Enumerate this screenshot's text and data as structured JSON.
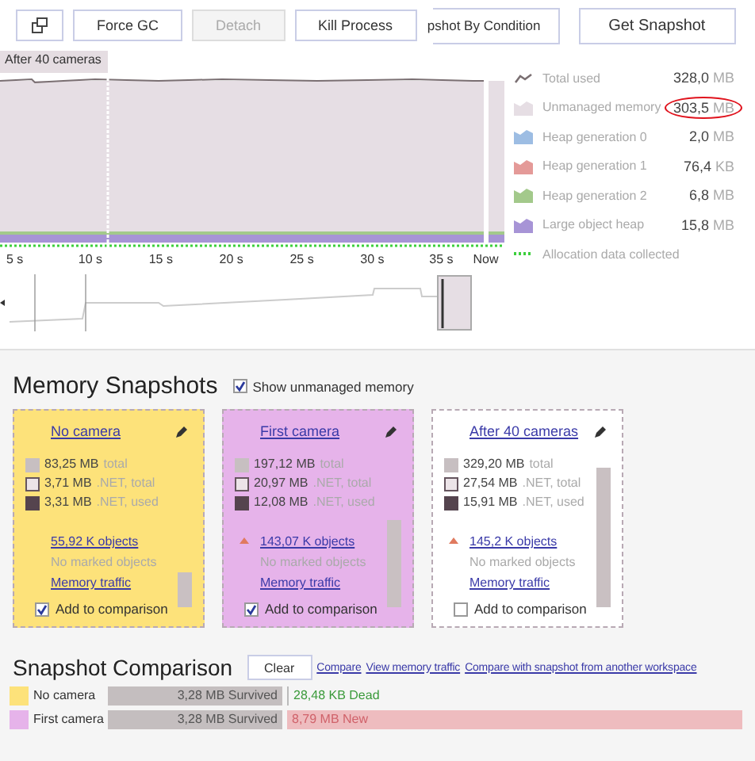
{
  "toolbar": {
    "buttons": [
      {
        "kind": "icon",
        "disabled": false
      },
      {
        "kind": "text",
        "label": "Force GC",
        "disabled": false
      },
      {
        "kind": "text",
        "label": "Detach",
        "disabled": true
      },
      {
        "kind": "text",
        "label": "Kill Process",
        "disabled": false
      },
      {
        "kind": "cut",
        "label": "pshot By Condition",
        "disabled": false
      },
      {
        "kind": "wide",
        "label": "Get Snapshot",
        "disabled": false
      }
    ]
  },
  "timeline": {
    "marker_label": "After 40 cameras",
    "time_axis": [
      "5 s",
      "10 s",
      "15 s",
      "20 s",
      "25 s",
      "30 s",
      "35 s",
      "Now"
    ]
  },
  "legend": [
    {
      "kind": "line",
      "color": "#7a6f72",
      "label": "Total used",
      "value": "328,0",
      "unit": "MB"
    },
    {
      "kind": "area",
      "color": "#e6dee4",
      "label": "Unmanaged memory",
      "value": "303,5",
      "unit": "MB",
      "highlighted": true
    },
    {
      "kind": "area",
      "color": "#9dbde3",
      "label": "Heap generation 0",
      "value": "2,0",
      "unit": "MB"
    },
    {
      "kind": "area",
      "color": "#e49a98",
      "label": "Heap generation 1",
      "value": "76,4",
      "unit": "KB"
    },
    {
      "kind": "area",
      "color": "#a3c98b",
      "label": "Heap generation 2",
      "value": "6,8",
      "unit": "MB"
    },
    {
      "kind": "area",
      "color": "#a794d6",
      "label": "Large object heap",
      "value": "15,8",
      "unit": "MB"
    },
    {
      "kind": "dots",
      "color": "#3ccf3c",
      "label": "Allocation data collected"
    }
  ],
  "snapshots": {
    "title": "Memory Snapshots",
    "show_unmanaged": {
      "label": "Show unmanaged memory",
      "checked": true
    },
    "cards": [
      {
        "title": "No camera",
        "color": "#fde27a",
        "stats": [
          {
            "amount": "83,25 MB",
            "kind": "total"
          },
          {
            "amount": "3,71 MB",
            "kind": "net_total"
          },
          {
            "amount": "3,31 MB",
            "kind": "net_used"
          }
        ],
        "stat_captions": [
          "total",
          ".NET, total",
          ".NET, used"
        ],
        "objects": "55,92 K objects",
        "increase": false,
        "marked": "No marked objects",
        "traffic": "Memory traffic",
        "compare_label": "Add to comparison",
        "checked": true
      },
      {
        "title": "First camera",
        "color": "#e6b3ea",
        "stats": [
          {
            "amount": "197,12 MB",
            "kind": "total"
          },
          {
            "amount": "20,97 MB",
            "kind": "net_total"
          },
          {
            "amount": "12,08 MB",
            "kind": "net_used"
          }
        ],
        "stat_captions": [
          "total",
          ".NET, total",
          ".NET, used"
        ],
        "objects": "143,07 K objects",
        "increase": true,
        "marked": "No marked objects",
        "traffic": "Memory traffic",
        "compare_label": "Add to comparison",
        "checked": true
      },
      {
        "title": "After 40 cameras",
        "color": "#ffffff",
        "stats": [
          {
            "amount": "329,20 MB",
            "kind": "total"
          },
          {
            "amount": "27,54 MB",
            "kind": "net_total"
          },
          {
            "amount": "15,91 MB",
            "kind": "net_used"
          }
        ],
        "stat_captions": [
          "total",
          ".NET, total",
          ".NET, used"
        ],
        "objects": "145,2 K objects",
        "increase": true,
        "marked": "No marked objects",
        "traffic": "Memory traffic",
        "compare_label": "Add to comparison",
        "checked": false
      }
    ]
  },
  "comparison": {
    "title": "Snapshot Comparison",
    "clear": "Clear",
    "links": [
      "Compare",
      "View memory traffic",
      "Compare with snapshot from another workspace"
    ],
    "rows": [
      {
        "name": "No camera",
        "color": "#fde27a",
        "survived": "3,28 MB Survived",
        "change": "28,48 KB Dead",
        "kind": "dead"
      },
      {
        "name": "First camera",
        "color": "#e6b3ea",
        "survived": "3,28 MB Survived",
        "change": "8,79 MB New",
        "kind": "new"
      }
    ]
  }
}
